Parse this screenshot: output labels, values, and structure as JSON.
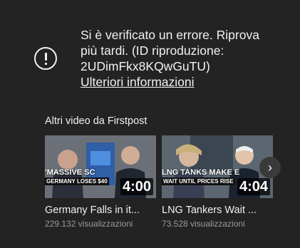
{
  "error": {
    "lines": [
      "Si è verificato un errore. Riprova",
      "più tardi. (ID riproduzione:",
      "2UDimFkx8KQwGuTU)"
    ],
    "link": "Ulteriori informazioni",
    "icon": "error-exclamation-icon"
  },
  "more": {
    "title": "Altri video da Firstpost",
    "videos": [
      {
        "title": "Germany Falls in it...",
        "views": "229.132 visualizzazioni",
        "duration": "4:00",
        "thumb_text": "'MASSIVE SC",
        "thumb_caption": "GERMANY LOSES $40"
      },
      {
        "title": "LNG Tankers Wait ...",
        "views": "73.528 visualizzazioni",
        "duration": "4:04",
        "thumb_text": "LNG TANKS MAKE E",
        "thumb_caption": "WAIT UNTIL PRICES RISE"
      }
    ],
    "next_icon": "chevron-right-icon"
  },
  "colors": {
    "background": "#232323",
    "text": "#f1f1f1",
    "secondary_text": "#9a9a9a"
  }
}
